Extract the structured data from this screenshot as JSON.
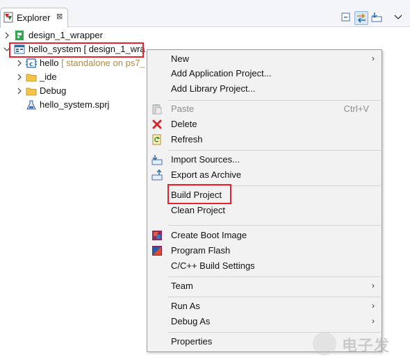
{
  "tab": {
    "title": "Explorer",
    "close_glyph": "⊠"
  },
  "toolbar": {
    "icons": [
      "collapse-all-icon",
      "link-with-editor-icon",
      "filters-icon",
      "view-menu-icon"
    ]
  },
  "tree": {
    "items": [
      {
        "label": "design_1_wrapper",
        "icon": "hw-platform-icon",
        "expanded": false,
        "depth": 0
      },
      {
        "label": "hello_system [ design_1_wra",
        "icon": "system-project-icon",
        "expanded": true,
        "depth": 0,
        "selected": true
      },
      {
        "label": "hello",
        "decoration": " [ standalone on ps7_",
        "icon": "c-project-icon",
        "expanded": false,
        "depth": 1
      },
      {
        "label": "_ide",
        "icon": "folder-icon",
        "expanded": false,
        "depth": 1
      },
      {
        "label": "Debug",
        "icon": "folder-icon",
        "expanded": false,
        "depth": 1
      },
      {
        "label": "hello_system.sprj",
        "icon": "flask-icon",
        "expanded": false,
        "depth": 1
      }
    ]
  },
  "menu": {
    "new": "New",
    "add_application_project": "Add Application Project...",
    "add_library_project": "Add Library Project...",
    "paste": "Paste",
    "paste_shortcut": "Ctrl+V",
    "delete": "Delete",
    "refresh": "Refresh",
    "import_sources": "Import Sources...",
    "export_as_archive": "Export as Archive",
    "build_project": "Build Project",
    "clean_project": "Clean Project",
    "create_boot_image": "Create Boot Image",
    "program_flash": "Program Flash",
    "build_settings": "C/C++ Build Settings",
    "team": "Team",
    "run_as": "Run As",
    "debug_as": "Debug As",
    "properties": "Properties",
    "submenu_arrow": "›"
  },
  "colors": {
    "highlight_box": "#e8212b",
    "menu_bg": "#f2f2f2",
    "decoration": "#b08a4a"
  },
  "watermark": {
    "text": "电子发"
  }
}
